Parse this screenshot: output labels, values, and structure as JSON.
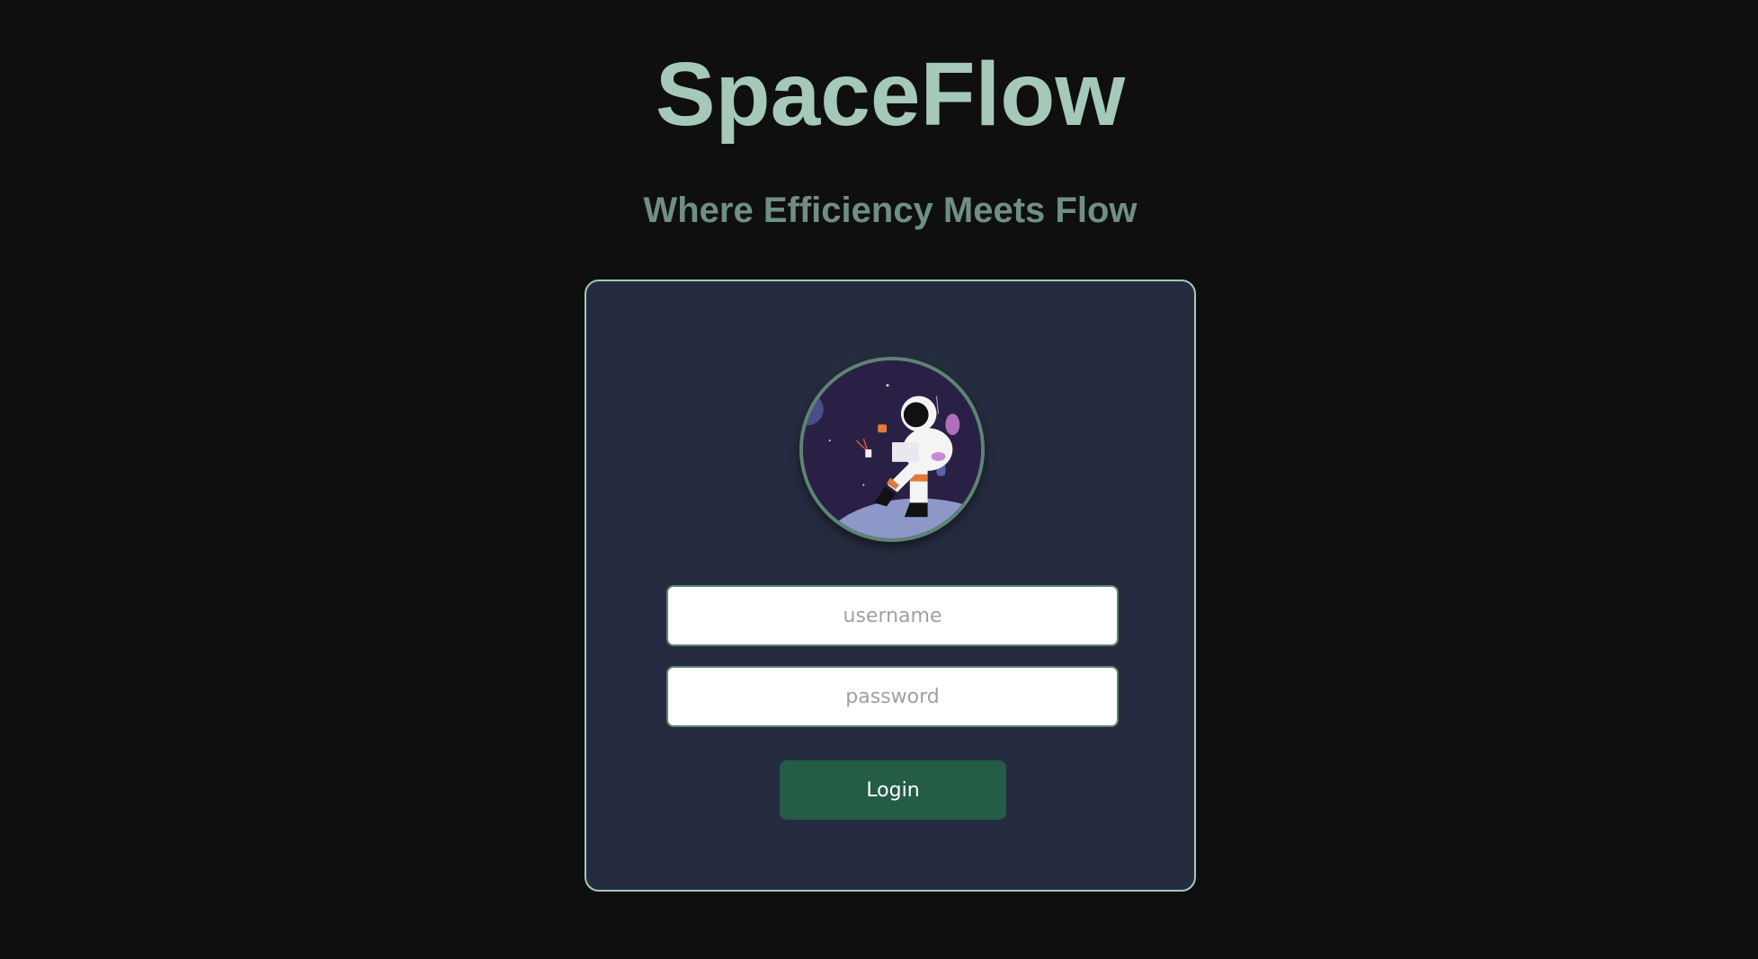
{
  "header": {
    "title": "SpaceFlow",
    "subtitle": "Where Efficiency Meets Flow"
  },
  "login": {
    "avatar_icon": "astronaut-illustration",
    "username_placeholder": "username",
    "username_value": "",
    "password_placeholder": "password",
    "password_value": "",
    "login_label": "Login"
  },
  "colors": {
    "background": "#0f0f0f",
    "accent": "#a5c8b9",
    "card": "#262c40",
    "button": "#245c45"
  }
}
